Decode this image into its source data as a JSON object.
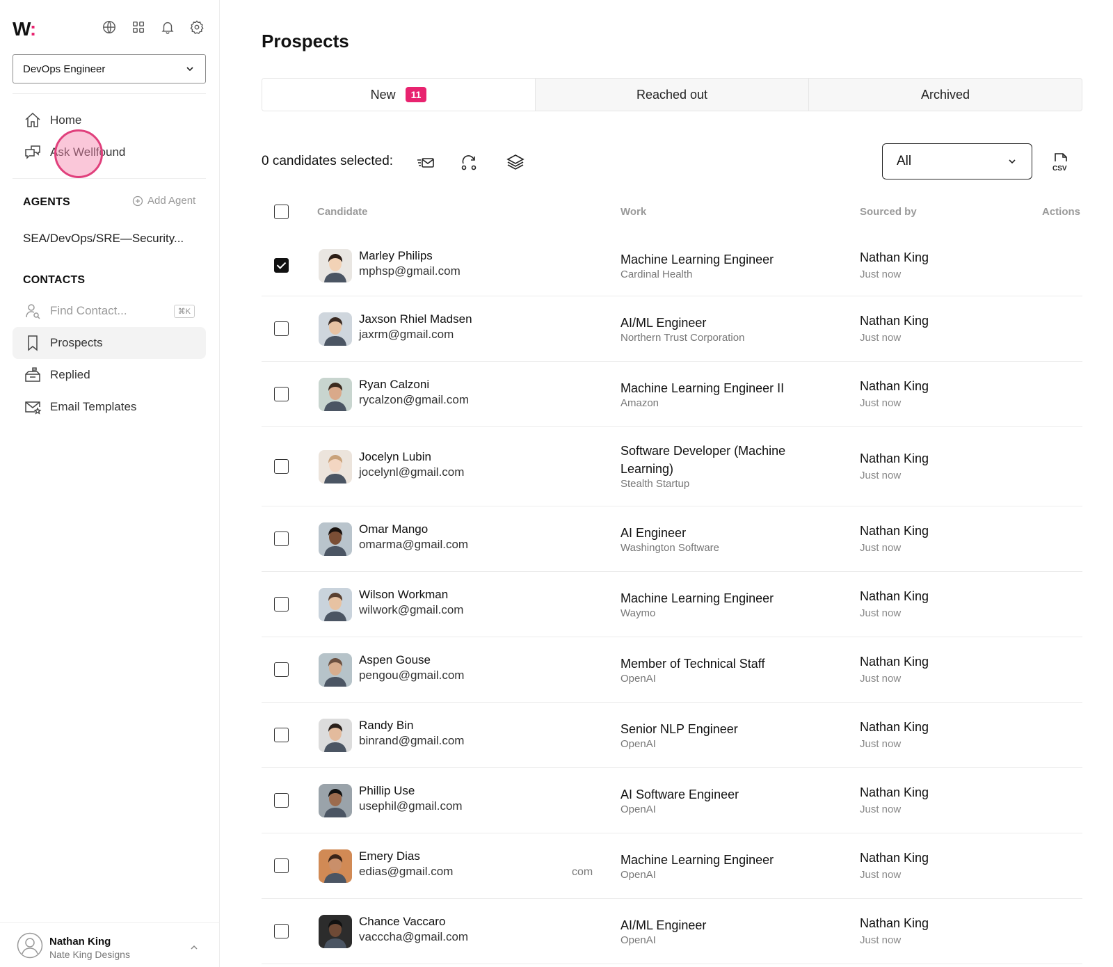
{
  "sidebar": {
    "logo_text": "W",
    "logo_accent": ":",
    "role_select": "DevOps Engineer",
    "nav_top": [
      {
        "label": "Home",
        "icon": "home-icon"
      },
      {
        "label": "Ask Wellfound",
        "icon": "chat-bubbles-icon"
      }
    ],
    "agents_heading": "AGENTS",
    "add_agent_label": "Add Agent",
    "agent_item": "SEA/DevOps/SRE—Security...",
    "contacts_heading": "CONTACTS",
    "find_contact_placeholder": "Find Contact...",
    "find_contact_shortcut": "⌘K",
    "contacts_items": [
      {
        "label": "Prospects",
        "icon": "bookmark-icon"
      },
      {
        "label": "Replied",
        "icon": "mailbox-icon"
      },
      {
        "label": "Email Templates",
        "icon": "email-template-icon"
      }
    ],
    "user": {
      "name": "Nathan King",
      "company": "Nate King Designs"
    }
  },
  "main": {
    "title": "Prospects",
    "tabs": [
      {
        "label": "New",
        "badge": "11"
      },
      {
        "label": "Reached out"
      },
      {
        "label": "Archived"
      }
    ],
    "selected_label": "0 candidates selected:",
    "filter_value": "All",
    "columns": {
      "candidate": "Candidate",
      "work": "Work",
      "sourced_by": "Sourced by",
      "actions": "Actions"
    },
    "rows": [
      {
        "name": "Marley Philips",
        "email": "mphsp@gmail.com",
        "title": "Machine Learning Engineer",
        "company": "Cardinal Health",
        "sourced_by": "Nathan King",
        "time": "Just now",
        "checked": true
      },
      {
        "name": "Jaxson Rhiel Madsen",
        "email": "jaxrm@gmail.com",
        "title": "AI/ML Engineer",
        "company": "Northern Trust Corporation",
        "sourced_by": "Nathan King",
        "time": "Just now",
        "checked": false
      },
      {
        "name": "Ryan Calzoni",
        "email": "rycalzon@gmail.com",
        "title": "Machine Learning Engineer II",
        "company": "Amazon",
        "sourced_by": "Nathan King",
        "time": "Just now",
        "checked": false
      },
      {
        "name": "Jocelyn Lubin",
        "email": "jocelynl@gmail.com",
        "title": "Software Developer (Machine Learning)",
        "company": "Stealth Startup",
        "sourced_by": "Nathan King",
        "time": "Just now",
        "checked": false
      },
      {
        "name": "Omar Mango",
        "email": "omarma@gmail.com",
        "title": "AI Engineer",
        "company": "Washington Software",
        "sourced_by": "Nathan King",
        "time": "Just now",
        "checked": false
      },
      {
        "name": "Wilson Workman",
        "email": "wilwork@gmail.com",
        "title": "Machine Learning Engineer",
        "company": "Waymo",
        "sourced_by": "Nathan King",
        "time": "Just now",
        "checked": false
      },
      {
        "name": "Aspen Gouse",
        "email": "pengou@gmail.com",
        "title": "Member of Technical Staff",
        "company": "OpenAI",
        "sourced_by": "Nathan King",
        "time": "Just now",
        "checked": false
      },
      {
        "name": "Randy Bin",
        "email": "binrand@gmail.com",
        "title": "Senior NLP Engineer",
        "company": "OpenAI",
        "sourced_by": "Nathan King",
        "time": "Just now",
        "checked": false
      },
      {
        "name": "Phillip Use",
        "email": "usephil@gmail.com",
        "title": "AI Software Engineer",
        "company": "OpenAI",
        "sourced_by": "Nathan King",
        "time": "Just now",
        "checked": false
      },
      {
        "name": "Emery Dias",
        "email": "edias@gmail.com",
        "ghost": "com",
        "title": "Machine Learning Engineer",
        "company": "OpenAI",
        "sourced_by": "Nathan King",
        "time": "Just now",
        "checked": false
      },
      {
        "name": "Chance Vaccaro",
        "email": "vacccha@gmail.com",
        "title": "AI/ML Engineer",
        "company": "OpenAI",
        "sourced_by": "Nathan King",
        "time": "Just now",
        "checked": false
      }
    ]
  },
  "colors": {
    "accent": "#e8236f",
    "cursor_highlight": "#e0407c"
  }
}
